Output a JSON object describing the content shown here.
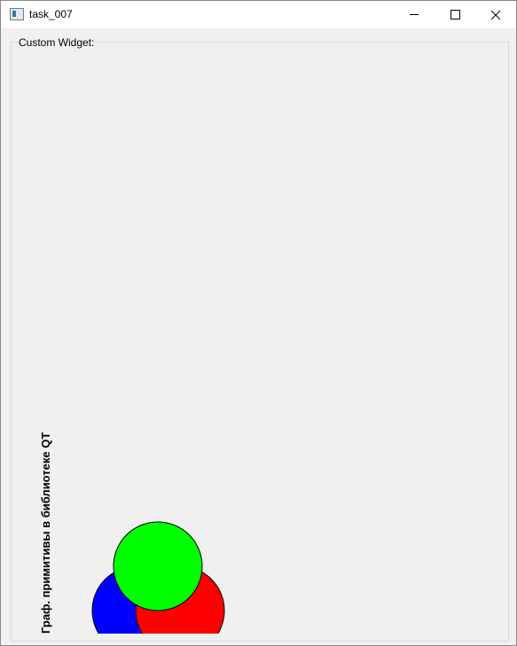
{
  "window": {
    "title": "task_007",
    "icons": {
      "app": "app-window-icon",
      "minimize": "minimize-icon",
      "maximize": "maximize-icon",
      "close": "close-icon"
    }
  },
  "group": {
    "title": "Custom Widget:"
  },
  "canvas": {
    "label": "Граф. примитивы в библиотеке QT",
    "circles": [
      {
        "name": "blue-circle",
        "color": "#0000ff"
      },
      {
        "name": "red-circle",
        "color": "#ff0000"
      },
      {
        "name": "green-circle",
        "color": "#00ff00"
      }
    ]
  }
}
